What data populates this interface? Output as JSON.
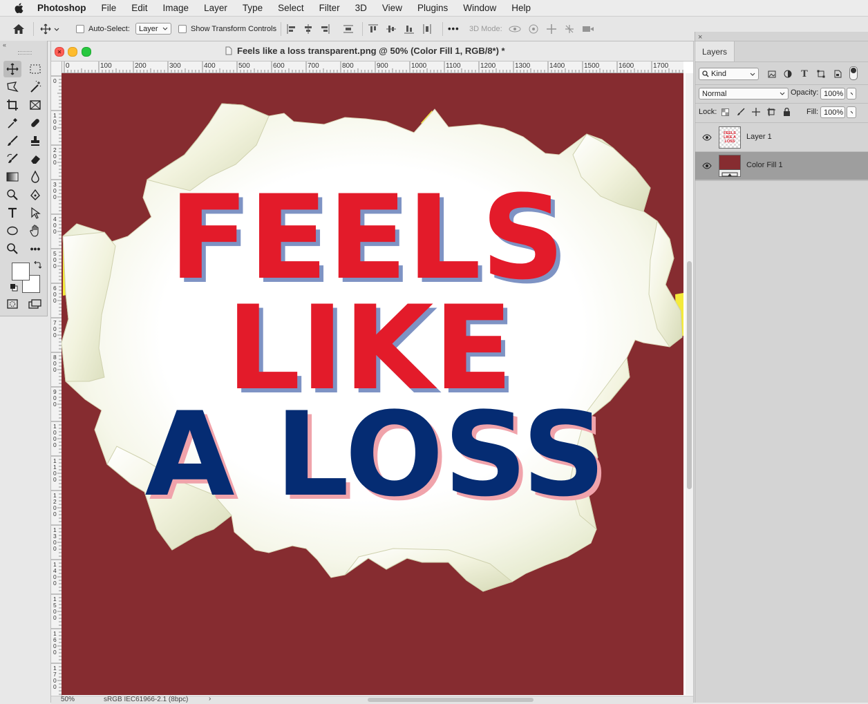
{
  "menubar": {
    "app_name": "Photoshop",
    "items": [
      "File",
      "Edit",
      "Image",
      "Layer",
      "Type",
      "Select",
      "Filter",
      "3D",
      "View",
      "Plugins",
      "Window",
      "Help"
    ]
  },
  "options": {
    "auto_select_label": "Auto-Select:",
    "auto_select_value": "Layer",
    "show_transform_label": "Show Transform Controls",
    "more_label": "•••",
    "mode_3d_label": "3D Mode:"
  },
  "document": {
    "title": "Feels like a loss transparent.png @ 50% (Color Fill 1, RGB/8*) *",
    "ruler_h": [
      "0",
      "100",
      "200",
      "300",
      "400",
      "500",
      "600",
      "700",
      "800",
      "900",
      "1000",
      "1100",
      "1200",
      "1300",
      "1400",
      "1500",
      "1600",
      "1700"
    ],
    "ruler_v": [
      "0",
      "1\n0\n0",
      "2\n0\n0",
      "3\n0\n0",
      "4\n0\n0",
      "5\n0\n0",
      "6\n0\n0",
      "7\n0\n0",
      "8\n0\n0",
      "9\n0\n0",
      "1\n0\n0\n0",
      "1\n1\n0\n0",
      "1\n2\n0\n0",
      "1\n3\n0\n0",
      "1\n4\n0\n0",
      "1\n5\n0\n0",
      "1\n6\n0\n0",
      "1\n7\n0\n0"
    ],
    "artwork": {
      "line1": "FEELS",
      "line2": "LIKE",
      "line3": "A LOSS",
      "background_color": "#862c30",
      "red_text_color": "#e31b2a",
      "blue_text_color": "#052c73"
    },
    "status": {
      "zoom": "50%",
      "profile": "sRGB IEC61966-2.1 (8bpc)",
      "arrow": "›"
    }
  },
  "layers_panel": {
    "tab_label": "Layers",
    "filter_label": "Kind",
    "blend_mode": "Normal",
    "opacity_label": "Opacity:",
    "opacity_value": "100%",
    "lock_label": "Lock:",
    "fill_label": "Fill:",
    "fill_value": "100%",
    "layers": [
      {
        "name": "Layer 1",
        "thumb_text": "FEELS LIKE A LOSS",
        "selected": false
      },
      {
        "name": "Color Fill 1",
        "selected": true
      }
    ]
  }
}
